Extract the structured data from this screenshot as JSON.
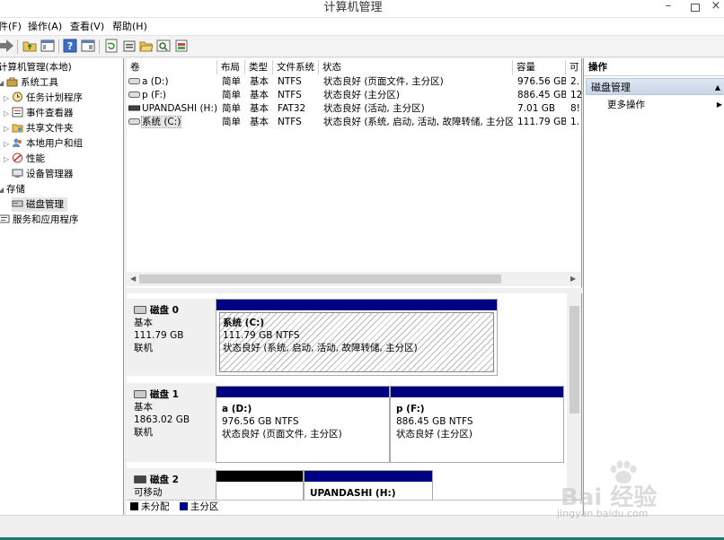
{
  "window": {
    "title": "计算机管理",
    "min": "–",
    "close": "×"
  },
  "menu": [
    "件(F)",
    "操作(A)",
    "查看(V)",
    "帮助(H)"
  ],
  "tree": {
    "root": "计算机管理(本地)",
    "system_tools": "系统工具",
    "task_scheduler": "任务计划程序",
    "event_viewer": "事件查看器",
    "shared_folders": "共享文件夹",
    "local_users": "本地用户和组",
    "performance": "性能",
    "device_manager": "设备管理器",
    "storage": "存储",
    "disk_management": "磁盘管理",
    "services_apps": "服务和应用程序"
  },
  "volume_list": {
    "columns": [
      "卷",
      "布局",
      "类型",
      "文件系统",
      "状态",
      "容量",
      "可"
    ],
    "rows": [
      {
        "volume": "a (D:)",
        "layout": "简单",
        "type": "基本",
        "fs": "NTFS",
        "status": "状态良好 (页面文件, 主分区)",
        "capacity": "976.56 GB",
        "free": "2."
      },
      {
        "volume": "p (F:)",
        "layout": "简单",
        "type": "基本",
        "fs": "NTFS",
        "status": "状态良好 (主分区)",
        "capacity": "886.45 GB",
        "free": "12"
      },
      {
        "volume": "UPANDASHI (H:)",
        "layout": "简单",
        "type": "基本",
        "fs": "FAT32",
        "status": "状态良好 (活动, 主分区)",
        "capacity": "7.01 GB",
        "free": "8!"
      },
      {
        "volume": "系统 (C:)",
        "layout": "简单",
        "type": "基本",
        "fs": "NTFS",
        "status": "状态良好 (系统, 启动, 活动, 故障转储, 主分区)",
        "capacity": "111.79 GB",
        "free": "1."
      }
    ]
  },
  "disks": [
    {
      "name": "磁盘 0",
      "kind": "基本",
      "size": "111.79 GB",
      "state": "联机",
      "partitions": [
        {
          "name": "系统  (C:)",
          "size": "111.79 GB NTFS",
          "status": "状态良好 (系统, 启动, 活动, 故障转储, 主分区)"
        }
      ]
    },
    {
      "name": "磁盘 1",
      "kind": "基本",
      "size": "1863.02 GB",
      "state": "联机",
      "partitions": [
        {
          "name": "a  (D:)",
          "size": "976.56 GB NTFS",
          "status": "状态良好 (页面文件, 主分区)"
        },
        {
          "name": "p  (F:)",
          "size": "886.45 GB NTFS",
          "status": "状态良好 (主分区)"
        }
      ]
    },
    {
      "name": "磁盘 2",
      "kind": "可移动",
      "size": "",
      "state": "",
      "partitions": [
        {
          "name": "",
          "size": "",
          "status": ""
        },
        {
          "name": "UPANDASHI  (H:)",
          "size": "",
          "status": ""
        }
      ]
    }
  ],
  "legend": {
    "unallocated": "未分配",
    "primary": "主分区"
  },
  "colors": {
    "primary": "#000080",
    "unallocated": "#000000",
    "accent_bar": "#1f7a6a"
  },
  "actions": {
    "header": "操作",
    "section": "磁盘管理",
    "more": "更多操作"
  },
  "watermark": {
    "text": "Bai 经验",
    "url": "jingyan.baidu.com"
  }
}
